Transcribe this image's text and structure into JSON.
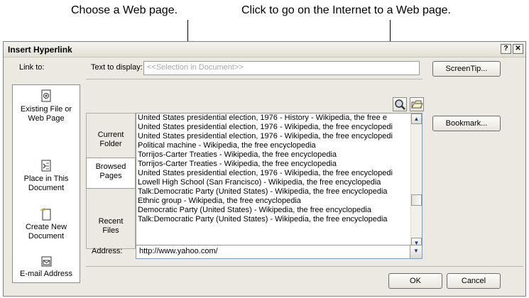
{
  "callouts": {
    "left": "Choose a Web page.",
    "right": "Click to go on the Internet to a Web page."
  },
  "dialog": {
    "title": "Insert Hyperlink",
    "help_label": "?",
    "close_label": "✕"
  },
  "link_to": {
    "label": "Link to:",
    "items": [
      {
        "label": "Existing File or Web Page",
        "icon": "existing-file-icon",
        "active": true
      },
      {
        "label": "Place in This Document",
        "icon": "place-in-document-icon",
        "active": false
      },
      {
        "label": "Create New Document",
        "icon": "new-document-icon",
        "active": false
      },
      {
        "label": "E-mail Address",
        "icon": "email-address-icon",
        "active": false
      }
    ]
  },
  "text_to_display": {
    "label": "Text to display:",
    "value": "<<Selection in Document>>"
  },
  "buttons": {
    "screentip": "ScreenTip...",
    "bookmark": "Bookmark...",
    "ok": "OK",
    "cancel": "Cancel"
  },
  "look_in": {
    "items": [
      {
        "label": "Current Folder",
        "active": false
      },
      {
        "label": "Browsed Pages",
        "active": true
      },
      {
        "label": "Recent Files",
        "active": false
      }
    ]
  },
  "file_list": [
    "United States presidential election, 1976 - History - Wikipedia, the free e",
    "United States presidential election, 1976 - Wikipedia, the free encyclopedi",
    "United States presidential election, 1976 - Wikipedia, the free encyclopedi",
    "Political machine - Wikipedia, the free encyclopedia",
    "Torrijos-Carter Treaties - Wikipedia, the free encyclopedia",
    "Torrijos-Carter Treaties - Wikipedia, the free encyclopedia",
    "United States presidential election, 1976 - Wikipedia, the free encyclopedi",
    "Lowell High School (San Francisco) - Wikipedia, the free encyclopedia",
    "Talk:Democratic Party (United States) - Wikipedia, the free encyclopedia",
    "Ethnic group - Wikipedia, the free encyclopedia",
    "Democratic Party (United States) - Wikipedia, the free encyclopedia",
    "Talk:Democratic Party (United States) - Wikipedia, the free encyclopedia"
  ],
  "address": {
    "label": "Address:",
    "value": "http://www.yahoo.com/"
  },
  "icons": {
    "browse_web": "browse-web-icon",
    "browse_file": "browse-file-icon"
  }
}
